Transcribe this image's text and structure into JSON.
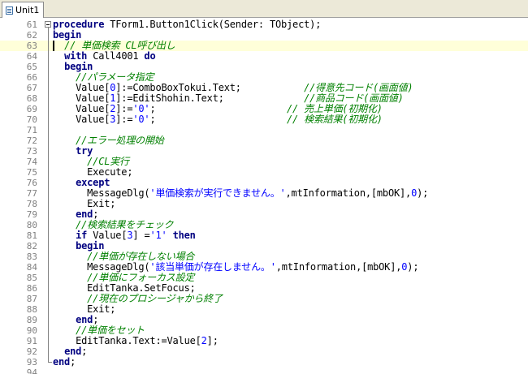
{
  "tab": {
    "label": "Unit1",
    "icon": "unit-file-icon"
  },
  "colors": {
    "keyword": "#000080",
    "comment": "#008000",
    "string": "#0000ff",
    "number": "#0000ff",
    "line_number": "#808080",
    "current_line": "#ffffd9"
  },
  "editor": {
    "current_line": 63,
    "lines": [
      {
        "n": "61",
        "tokens": [
          {
            "t": "kw",
            "v": "procedure"
          },
          {
            "t": "tx",
            "v": " TForm1.Button1Click(Sender: TObject);"
          }
        ]
      },
      {
        "n": "62",
        "tokens": [
          {
            "t": "kw",
            "v": "begin"
          }
        ]
      },
      {
        "n": "63",
        "tokens": [
          {
            "t": "tx",
            "v": "  "
          },
          {
            "t": "cm",
            "v": "// 単価検索 CL呼び出し"
          }
        ]
      },
      {
        "n": "64",
        "tokens": [
          {
            "t": "tx",
            "v": "  "
          },
          {
            "t": "kw",
            "v": "with"
          },
          {
            "t": "tx",
            "v": " Call4001 "
          },
          {
            "t": "kw",
            "v": "do"
          }
        ]
      },
      {
        "n": "65",
        "tokens": [
          {
            "t": "tx",
            "v": "  "
          },
          {
            "t": "kw",
            "v": "begin"
          }
        ]
      },
      {
        "n": "66",
        "tokens": [
          {
            "t": "tx",
            "v": "    "
          },
          {
            "t": "cm",
            "v": "//パラメータ指定"
          }
        ]
      },
      {
        "n": "67",
        "tokens": [
          {
            "t": "tx",
            "v": "    Value["
          },
          {
            "t": "nm",
            "v": "0"
          },
          {
            "t": "tx",
            "v": "]:=ComboBoxTokui.Text;           "
          },
          {
            "t": "cm",
            "v": "//得意先コード(画面値)"
          }
        ]
      },
      {
        "n": "68",
        "tokens": [
          {
            "t": "tx",
            "v": "    Value["
          },
          {
            "t": "nm",
            "v": "1"
          },
          {
            "t": "tx",
            "v": "]:=EditShohin.Text;              "
          },
          {
            "t": "cm",
            "v": "//商品コード(画面値)"
          }
        ]
      },
      {
        "n": "69",
        "tokens": [
          {
            "t": "tx",
            "v": "    Value["
          },
          {
            "t": "nm",
            "v": "2"
          },
          {
            "t": "tx",
            "v": "]:="
          },
          {
            "t": "st",
            "v": "'0'"
          },
          {
            "t": "tx",
            "v": ";                       "
          },
          {
            "t": "cm",
            "v": "// 売上単価(初期化)"
          }
        ]
      },
      {
        "n": "70",
        "tokens": [
          {
            "t": "tx",
            "v": "    Value["
          },
          {
            "t": "nm",
            "v": "3"
          },
          {
            "t": "tx",
            "v": "]:="
          },
          {
            "t": "st",
            "v": "'0'"
          },
          {
            "t": "tx",
            "v": ";                       "
          },
          {
            "t": "cm",
            "v": "// 検索結果(初期化)"
          }
        ]
      },
      {
        "n": "71",
        "tokens": []
      },
      {
        "n": "72",
        "tokens": [
          {
            "t": "tx",
            "v": "    "
          },
          {
            "t": "cm",
            "v": "//エラー処理の開始"
          }
        ]
      },
      {
        "n": "73",
        "tokens": [
          {
            "t": "tx",
            "v": "    "
          },
          {
            "t": "kw",
            "v": "try"
          }
        ]
      },
      {
        "n": "74",
        "tokens": [
          {
            "t": "tx",
            "v": "      "
          },
          {
            "t": "cm",
            "v": "//CL実行"
          }
        ]
      },
      {
        "n": "75",
        "tokens": [
          {
            "t": "tx",
            "v": "      Execute;"
          }
        ]
      },
      {
        "n": "76",
        "tokens": [
          {
            "t": "tx",
            "v": "    "
          },
          {
            "t": "kw",
            "v": "except"
          }
        ]
      },
      {
        "n": "77",
        "tokens": [
          {
            "t": "tx",
            "v": "      MessageDlg("
          },
          {
            "t": "st",
            "v": "'単価検索が実行できません。'"
          },
          {
            "t": "tx",
            "v": ",mtInformation,[mbOK],"
          },
          {
            "t": "nm",
            "v": "0"
          },
          {
            "t": "tx",
            "v": ");"
          }
        ]
      },
      {
        "n": "78",
        "tokens": [
          {
            "t": "tx",
            "v": "      Exit;"
          }
        ]
      },
      {
        "n": "79",
        "tokens": [
          {
            "t": "tx",
            "v": "    "
          },
          {
            "t": "kw",
            "v": "end"
          },
          {
            "t": "tx",
            "v": ";"
          }
        ]
      },
      {
        "n": "80",
        "tokens": [
          {
            "t": "tx",
            "v": "    "
          },
          {
            "t": "cm",
            "v": "//検索結果をチェック"
          }
        ]
      },
      {
        "n": "81",
        "tokens": [
          {
            "t": "tx",
            "v": "    "
          },
          {
            "t": "kw",
            "v": "if"
          },
          {
            "t": "tx",
            "v": " Value["
          },
          {
            "t": "nm",
            "v": "3"
          },
          {
            "t": "tx",
            "v": "] ="
          },
          {
            "t": "st",
            "v": "'1'"
          },
          {
            "t": "tx",
            "v": " "
          },
          {
            "t": "kw",
            "v": "then"
          }
        ]
      },
      {
        "n": "82",
        "tokens": [
          {
            "t": "tx",
            "v": "    "
          },
          {
            "t": "kw",
            "v": "begin"
          }
        ]
      },
      {
        "n": "83",
        "tokens": [
          {
            "t": "tx",
            "v": "      "
          },
          {
            "t": "cm",
            "v": "//単価が存在しない場合"
          }
        ]
      },
      {
        "n": "84",
        "tokens": [
          {
            "t": "tx",
            "v": "      MessageDlg("
          },
          {
            "t": "st",
            "v": "'該当単価が存在しません。'"
          },
          {
            "t": "tx",
            "v": ",mtInformation,[mbOK],"
          },
          {
            "t": "nm",
            "v": "0"
          },
          {
            "t": "tx",
            "v": ");"
          }
        ]
      },
      {
        "n": "85",
        "tokens": [
          {
            "t": "tx",
            "v": "      "
          },
          {
            "t": "cm",
            "v": "//単価にフォーカス設定"
          }
        ]
      },
      {
        "n": "86",
        "tokens": [
          {
            "t": "tx",
            "v": "      EditTanka.SetFocus;"
          }
        ]
      },
      {
        "n": "87",
        "tokens": [
          {
            "t": "tx",
            "v": "      "
          },
          {
            "t": "cm",
            "v": "//現在のプロシージャから終了"
          }
        ]
      },
      {
        "n": "88",
        "tokens": [
          {
            "t": "tx",
            "v": "      Exit;"
          }
        ]
      },
      {
        "n": "89",
        "tokens": [
          {
            "t": "tx",
            "v": "    "
          },
          {
            "t": "kw",
            "v": "end"
          },
          {
            "t": "tx",
            "v": ";"
          }
        ]
      },
      {
        "n": "90",
        "tokens": [
          {
            "t": "tx",
            "v": "    "
          },
          {
            "t": "cm",
            "v": "//単価をセット"
          }
        ]
      },
      {
        "n": "91",
        "tokens": [
          {
            "t": "tx",
            "v": "    EditTanka.Text:=Value["
          },
          {
            "t": "nm",
            "v": "2"
          },
          {
            "t": "tx",
            "v": "];"
          }
        ]
      },
      {
        "n": "92",
        "tokens": [
          {
            "t": "tx",
            "v": "  "
          },
          {
            "t": "kw",
            "v": "end"
          },
          {
            "t": "tx",
            "v": ";"
          }
        ]
      },
      {
        "n": "93",
        "tokens": [
          {
            "t": "kw",
            "v": "end"
          },
          {
            "t": "tx",
            "v": ";"
          }
        ]
      },
      {
        "n": "94",
        "tokens": []
      }
    ]
  }
}
